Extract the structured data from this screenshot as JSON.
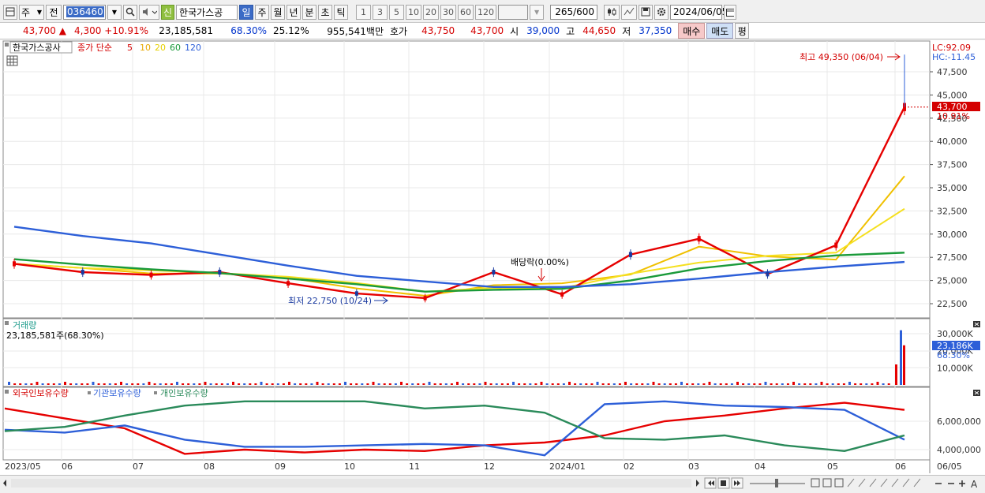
{
  "toolbar": {
    "market_type": "주",
    "prev_label": "전",
    "stock_code": "036460",
    "credit_badge": "신",
    "stock_name": "한국가스공",
    "periods": [
      "일",
      "주",
      "월",
      "년",
      "분",
      "초",
      "틱"
    ],
    "selected_period": "일",
    "intervals": [
      "1",
      "3",
      "5",
      "10",
      "20",
      "30",
      "60",
      "120"
    ],
    "count_value": "265",
    "count_total": "/600",
    "date": "2024/06/05"
  },
  "quote": {
    "price": "43,700",
    "arrow": "▲",
    "change": "4,300",
    "change_pct": "+10.91%",
    "volume": "23,185,581",
    "vol_ratio": "68.30%",
    "turnover": "25.12%",
    "amount": "955,541백만",
    "ask_label": "호가",
    "ask": "43,750",
    "bid": "43,700",
    "open_label": "시",
    "open": "39,000",
    "high_label": "고",
    "high": "44,650",
    "low_label": "저",
    "low": "37,350",
    "buy_btn": "매수",
    "sell_btn": "매도",
    "eval_btn": "평"
  },
  "price_panel": {
    "legend_name": "한국가스공사",
    "legend_type": "종가 단순",
    "ma_periods": [
      "5",
      "10",
      "20",
      "60",
      "120"
    ],
    "lc": "LC:92.09",
    "hc": "HC:-11.45",
    "max_annotation": "최고 49,350 (06/04)",
    "min_annotation": "최저 22,750 (10/24)",
    "dividend_annotation": "배당락(0.00%)",
    "current_tag": "43,700",
    "current_pct": "10.91%",
    "y_labels": [
      "47,500",
      "45,000",
      "42,500",
      "40,000",
      "37,500",
      "35,000",
      "32,500",
      "30,000",
      "27,500",
      "25,000",
      "22,500"
    ]
  },
  "volume_panel": {
    "title": "거래량",
    "value_text": "23,185,581주(68.30%)",
    "current_tag": "23,186K",
    "current_pct": "68.30%",
    "y_labels": [
      "30,000K",
      "20,000K",
      "10,000K"
    ]
  },
  "holding_panel": {
    "legend": [
      "외국인보유수량",
      "기관보유수량",
      "개인보유수량"
    ],
    "y_labels": [
      "6,000,000",
      "4,000,000"
    ]
  },
  "x_axis": [
    "2023/05",
    "06",
    "07",
    "08",
    "09",
    "10",
    "11",
    "12",
    "2024/01",
    "02",
    "03",
    "04",
    "05",
    "06",
    "06/05"
  ],
  "colors": {
    "ma5": "#e60000",
    "ma10": "#f0c000",
    "ma20": "#f5e020",
    "ma60": "#1a9a3a",
    "ma120": "#2d5fd8",
    "foreign": "#e60000",
    "institution": "#2d5fd8",
    "individual": "#2a8a5a"
  },
  "chart_data": {
    "type": "line",
    "title": "한국가스공사",
    "x": [
      "2023/05",
      "2023/06",
      "2023/07",
      "2023/08",
      "2023/09",
      "2023/10",
      "2023/11",
      "2023/12",
      "2024/01",
      "2024/02",
      "2024/03",
      "2024/04",
      "2024/05",
      "2024/06"
    ],
    "series": [
      {
        "name": "5",
        "values": [
          26800,
          25900,
          25600,
          25900,
          24700,
          23600,
          23100,
          25900,
          23500,
          27800,
          29500,
          25700,
          28800,
          43700
        ]
      },
      {
        "name": "60",
        "values": [
          27300,
          26700,
          26200,
          25800,
          25200,
          24600,
          23800,
          24000,
          24100,
          25000,
          26300,
          27100,
          27700,
          28000
        ]
      },
      {
        "name": "120",
        "values": [
          30800,
          29800,
          29000,
          27800,
          26600,
          25500,
          24900,
          24300,
          24300,
          24600,
          25200,
          25900,
          26500,
          27000
        ]
      }
    ],
    "ylim": [
      21500,
      49350
    ],
    "max": {
      "label": "최고",
      "value": 49350,
      "date": "06/04"
    },
    "min": {
      "label": "최저",
      "value": 22750,
      "date": "10/24"
    }
  }
}
